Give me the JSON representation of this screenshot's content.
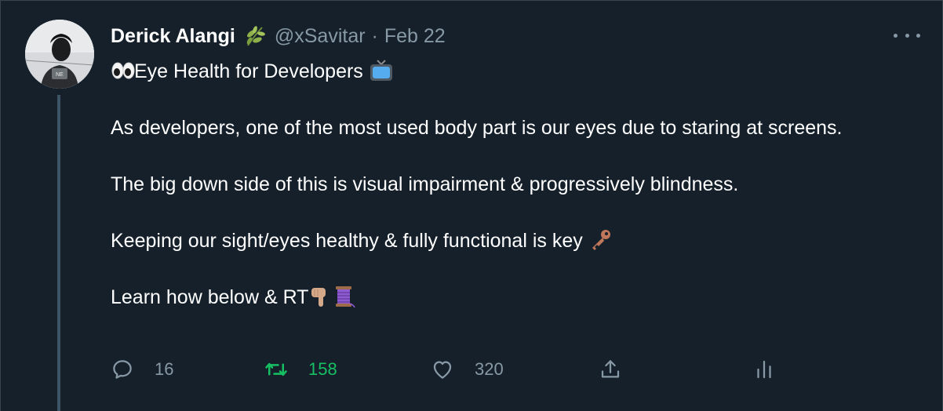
{
  "tweet": {
    "author": {
      "display_name": "Derick Alangi",
      "name_emoji": "herb-icon",
      "handle": "@xSavitar",
      "separator": "·",
      "date": "Feb 22"
    },
    "more_icon": "more-horizontal-icon",
    "body": {
      "title": "Eye Health for Developers",
      "title_prefix_emoji": "eyes-emoji",
      "title_suffix_emoji": "television-emoji",
      "paragraphs": [
        "As developers, one of the most used body part is our eyes due to staring at screens.",
        "The big down side of this is visual impairment & progressively blindness.",
        "Keeping our sight/eyes healthy & fully functional is key",
        "Learn how below & RT"
      ],
      "key_emoji": "key-emoji",
      "pointing_down_emoji": "pointing-down-emoji",
      "thread_emoji": "thread-spool-emoji"
    },
    "actions": {
      "replies": "16",
      "retweets": "158",
      "likes": "320"
    },
    "colors": {
      "background": "#15202b",
      "border": "#38444d",
      "secondary_text": "#8899a6",
      "retweet_green": "#17bf63",
      "thread_line": "#3d5466"
    }
  }
}
